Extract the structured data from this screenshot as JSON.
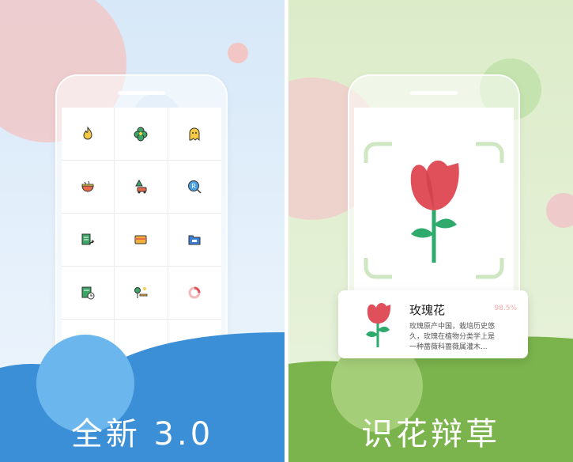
{
  "left_panel": {
    "caption": "全新 3.0",
    "icons": [
      {
        "name": "fire-icon"
      },
      {
        "name": "flower-clover-icon"
      },
      {
        "name": "ghost-icon"
      },
      {
        "name": "bowl-icon"
      },
      {
        "name": "car-tree-icon"
      },
      {
        "name": "search-r-icon"
      },
      {
        "name": "document-arrow-icon"
      },
      {
        "name": "wallet-icon"
      },
      {
        "name": "folder-icon"
      },
      {
        "name": "schedule-icon"
      },
      {
        "name": "park-icon"
      },
      {
        "name": "loading-ring-icon"
      }
    ],
    "colors": {
      "background": "#d7e8f8",
      "wave_dark": "#3b8fd6",
      "wave_light": "#6cb6ee",
      "circle": "#f1c8c8"
    }
  },
  "right_panel": {
    "caption": "识花辩草",
    "card": {
      "title": "玫瑰花",
      "score": "98.5%",
      "description": "玫瑰原产中国，栽培历史悠久，玫瑰在植物分类学上是一种蔷薇科蔷薇属灌木..."
    },
    "colors": {
      "background": "#dcecc9",
      "wave_dark": "#7bb44c",
      "wave_light": "#a4cf78",
      "flower": "#e0505a",
      "stem": "#2eaa6c",
      "frame": "#cfe6c2"
    }
  }
}
